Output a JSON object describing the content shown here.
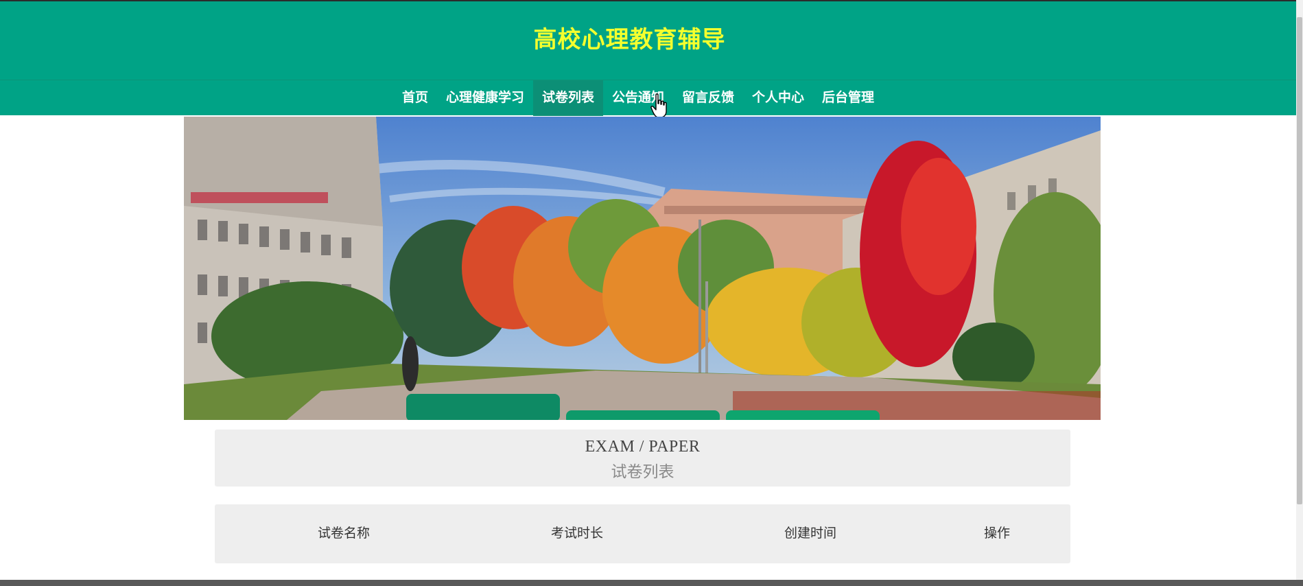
{
  "header": {
    "title": "高校心理教育辅导",
    "title_color": "#f4ff2e",
    "background_color": "#00a386"
  },
  "nav": {
    "items": [
      {
        "label": "首页",
        "active": false
      },
      {
        "label": "心理健康学习",
        "active": false
      },
      {
        "label": "试卷列表",
        "active": true
      },
      {
        "label": "公告通知",
        "active": false
      },
      {
        "label": "留言反馈",
        "active": false
      },
      {
        "label": "个人中心",
        "active": false
      },
      {
        "label": "后台管理",
        "active": false
      }
    ]
  },
  "banner": {
    "description_icon": "campus-photo",
    "indicator_count": 3,
    "active_indicator": 1
  },
  "section": {
    "title_en": "EXAM / PAPER",
    "title_cn": "试卷列表"
  },
  "table": {
    "columns": [
      "试卷名称",
      "考试时长",
      "创建时间",
      "操作"
    ]
  }
}
